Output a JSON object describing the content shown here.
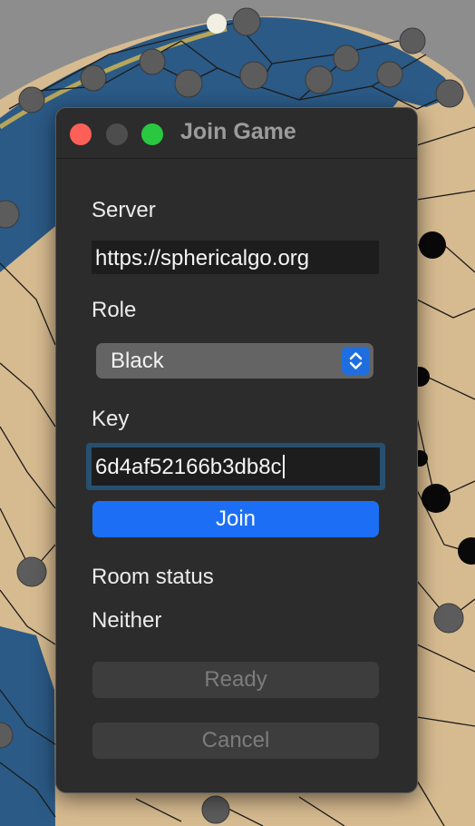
{
  "window": {
    "title": "Join Game"
  },
  "form": {
    "server_label": "Server",
    "server_value": "https://sphericalgo.org",
    "role_label": "Role",
    "role_value": "Black",
    "key_label": "Key",
    "key_value": "6d4af52166b3db8c",
    "join_label": "Join",
    "room_status_label": "Room status",
    "room_status_value": "Neither",
    "ready_label": "Ready",
    "cancel_label": "Cancel"
  },
  "colors": {
    "accent": "#1c6ff5",
    "close": "#fe5f57",
    "zoom": "#29c840",
    "board_blue": "#2b5a86",
    "board_tan": "#d7bb90"
  },
  "icons": {
    "select_arrows": "up-down-chevron-icon"
  }
}
